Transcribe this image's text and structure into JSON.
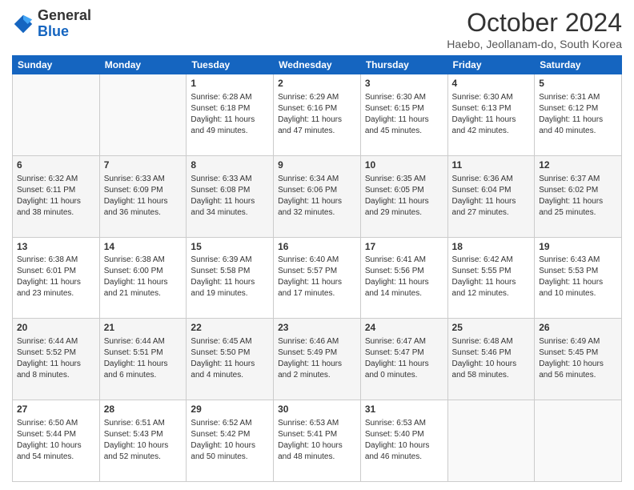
{
  "header": {
    "logo_general": "General",
    "logo_blue": "Blue",
    "month_title": "October 2024",
    "subtitle": "Haebo, Jeollanam-do, South Korea"
  },
  "days": [
    "Sunday",
    "Monday",
    "Tuesday",
    "Wednesday",
    "Thursday",
    "Friday",
    "Saturday"
  ],
  "weeks": [
    [
      {
        "day": "",
        "sunrise": "",
        "sunset": "",
        "daylight": ""
      },
      {
        "day": "",
        "sunrise": "",
        "sunset": "",
        "daylight": ""
      },
      {
        "day": "1",
        "sunrise": "Sunrise: 6:28 AM",
        "sunset": "Sunset: 6:18 PM",
        "daylight": "Daylight: 11 hours and 49 minutes."
      },
      {
        "day": "2",
        "sunrise": "Sunrise: 6:29 AM",
        "sunset": "Sunset: 6:16 PM",
        "daylight": "Daylight: 11 hours and 47 minutes."
      },
      {
        "day": "3",
        "sunrise": "Sunrise: 6:30 AM",
        "sunset": "Sunset: 6:15 PM",
        "daylight": "Daylight: 11 hours and 45 minutes."
      },
      {
        "day": "4",
        "sunrise": "Sunrise: 6:30 AM",
        "sunset": "Sunset: 6:13 PM",
        "daylight": "Daylight: 11 hours and 42 minutes."
      },
      {
        "day": "5",
        "sunrise": "Sunrise: 6:31 AM",
        "sunset": "Sunset: 6:12 PM",
        "daylight": "Daylight: 11 hours and 40 minutes."
      }
    ],
    [
      {
        "day": "6",
        "sunrise": "Sunrise: 6:32 AM",
        "sunset": "Sunset: 6:11 PM",
        "daylight": "Daylight: 11 hours and 38 minutes."
      },
      {
        "day": "7",
        "sunrise": "Sunrise: 6:33 AM",
        "sunset": "Sunset: 6:09 PM",
        "daylight": "Daylight: 11 hours and 36 minutes."
      },
      {
        "day": "8",
        "sunrise": "Sunrise: 6:33 AM",
        "sunset": "Sunset: 6:08 PM",
        "daylight": "Daylight: 11 hours and 34 minutes."
      },
      {
        "day": "9",
        "sunrise": "Sunrise: 6:34 AM",
        "sunset": "Sunset: 6:06 PM",
        "daylight": "Daylight: 11 hours and 32 minutes."
      },
      {
        "day": "10",
        "sunrise": "Sunrise: 6:35 AM",
        "sunset": "Sunset: 6:05 PM",
        "daylight": "Daylight: 11 hours and 29 minutes."
      },
      {
        "day": "11",
        "sunrise": "Sunrise: 6:36 AM",
        "sunset": "Sunset: 6:04 PM",
        "daylight": "Daylight: 11 hours and 27 minutes."
      },
      {
        "day": "12",
        "sunrise": "Sunrise: 6:37 AM",
        "sunset": "Sunset: 6:02 PM",
        "daylight": "Daylight: 11 hours and 25 minutes."
      }
    ],
    [
      {
        "day": "13",
        "sunrise": "Sunrise: 6:38 AM",
        "sunset": "Sunset: 6:01 PM",
        "daylight": "Daylight: 11 hours and 23 minutes."
      },
      {
        "day": "14",
        "sunrise": "Sunrise: 6:38 AM",
        "sunset": "Sunset: 6:00 PM",
        "daylight": "Daylight: 11 hours and 21 minutes."
      },
      {
        "day": "15",
        "sunrise": "Sunrise: 6:39 AM",
        "sunset": "Sunset: 5:58 PM",
        "daylight": "Daylight: 11 hours and 19 minutes."
      },
      {
        "day": "16",
        "sunrise": "Sunrise: 6:40 AM",
        "sunset": "Sunset: 5:57 PM",
        "daylight": "Daylight: 11 hours and 17 minutes."
      },
      {
        "day": "17",
        "sunrise": "Sunrise: 6:41 AM",
        "sunset": "Sunset: 5:56 PM",
        "daylight": "Daylight: 11 hours and 14 minutes."
      },
      {
        "day": "18",
        "sunrise": "Sunrise: 6:42 AM",
        "sunset": "Sunset: 5:55 PM",
        "daylight": "Daylight: 11 hours and 12 minutes."
      },
      {
        "day": "19",
        "sunrise": "Sunrise: 6:43 AM",
        "sunset": "Sunset: 5:53 PM",
        "daylight": "Daylight: 11 hours and 10 minutes."
      }
    ],
    [
      {
        "day": "20",
        "sunrise": "Sunrise: 6:44 AM",
        "sunset": "Sunset: 5:52 PM",
        "daylight": "Daylight: 11 hours and 8 minutes."
      },
      {
        "day": "21",
        "sunrise": "Sunrise: 6:44 AM",
        "sunset": "Sunset: 5:51 PM",
        "daylight": "Daylight: 11 hours and 6 minutes."
      },
      {
        "day": "22",
        "sunrise": "Sunrise: 6:45 AM",
        "sunset": "Sunset: 5:50 PM",
        "daylight": "Daylight: 11 hours and 4 minutes."
      },
      {
        "day": "23",
        "sunrise": "Sunrise: 6:46 AM",
        "sunset": "Sunset: 5:49 PM",
        "daylight": "Daylight: 11 hours and 2 minutes."
      },
      {
        "day": "24",
        "sunrise": "Sunrise: 6:47 AM",
        "sunset": "Sunset: 5:47 PM",
        "daylight": "Daylight: 11 hours and 0 minutes."
      },
      {
        "day": "25",
        "sunrise": "Sunrise: 6:48 AM",
        "sunset": "Sunset: 5:46 PM",
        "daylight": "Daylight: 10 hours and 58 minutes."
      },
      {
        "day": "26",
        "sunrise": "Sunrise: 6:49 AM",
        "sunset": "Sunset: 5:45 PM",
        "daylight": "Daylight: 10 hours and 56 minutes."
      }
    ],
    [
      {
        "day": "27",
        "sunrise": "Sunrise: 6:50 AM",
        "sunset": "Sunset: 5:44 PM",
        "daylight": "Daylight: 10 hours and 54 minutes."
      },
      {
        "day": "28",
        "sunrise": "Sunrise: 6:51 AM",
        "sunset": "Sunset: 5:43 PM",
        "daylight": "Daylight: 10 hours and 52 minutes."
      },
      {
        "day": "29",
        "sunrise": "Sunrise: 6:52 AM",
        "sunset": "Sunset: 5:42 PM",
        "daylight": "Daylight: 10 hours and 50 minutes."
      },
      {
        "day": "30",
        "sunrise": "Sunrise: 6:53 AM",
        "sunset": "Sunset: 5:41 PM",
        "daylight": "Daylight: 10 hours and 48 minutes."
      },
      {
        "day": "31",
        "sunrise": "Sunrise: 6:53 AM",
        "sunset": "Sunset: 5:40 PM",
        "daylight": "Daylight: 10 hours and 46 minutes."
      },
      {
        "day": "",
        "sunrise": "",
        "sunset": "",
        "daylight": ""
      },
      {
        "day": "",
        "sunrise": "",
        "sunset": "",
        "daylight": ""
      }
    ]
  ]
}
